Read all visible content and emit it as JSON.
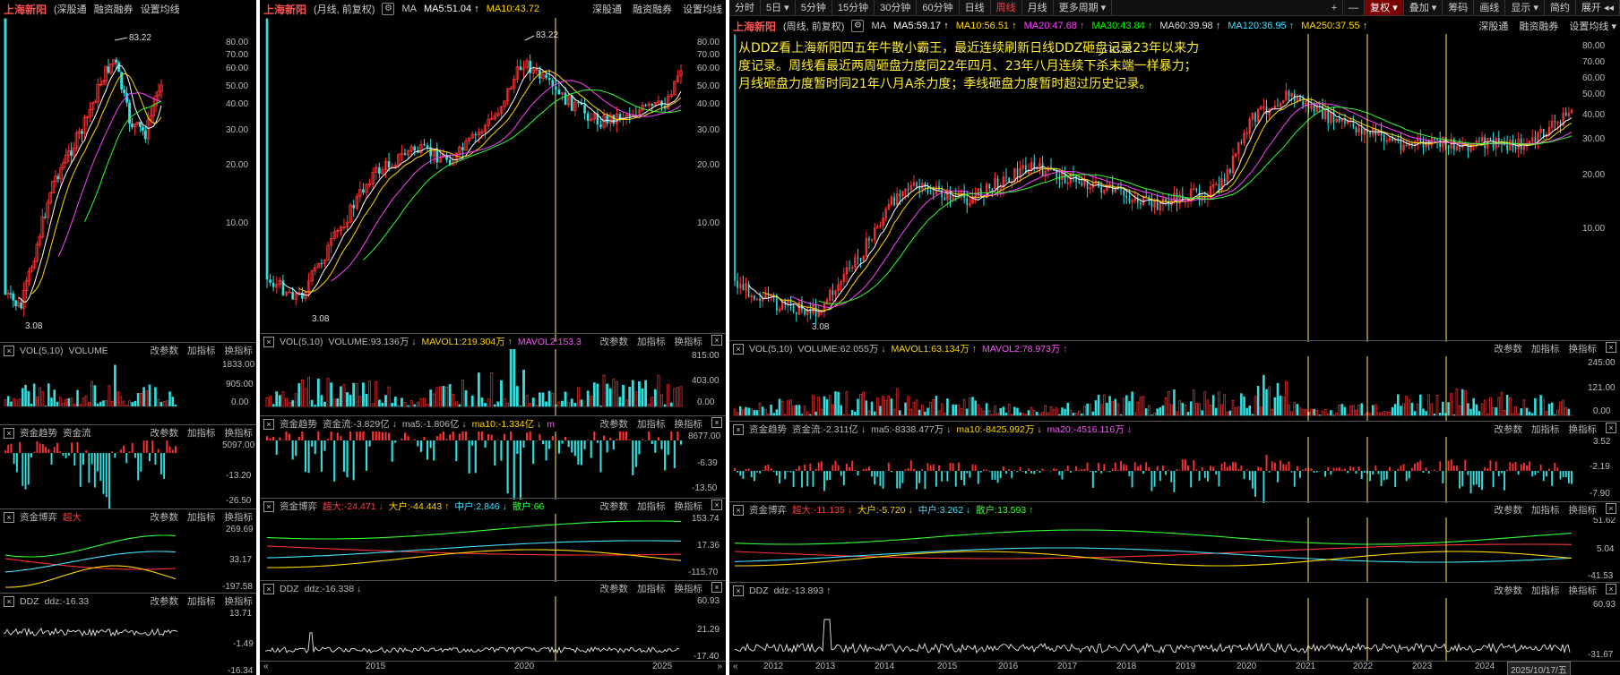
{
  "colors": {
    "up": "#ff3030",
    "down": "#30e0e0",
    "ma_yellow": "#ffd700",
    "ma_magenta": "#ff40ff",
    "ma_green": "#30ff30",
    "annotation": "#ffee33",
    "vline": "#ffee55"
  },
  "panel1": {
    "stock_name": "上海新阳",
    "tag": "(深股通",
    "links": [
      "融资融券",
      "设置均线"
    ],
    "high_label": "83.22",
    "low_label": "3.08",
    "price_ticks": [
      "80.00",
      "70.00",
      "60.00",
      "50.00",
      "40.00",
      "30.00",
      "20.00",
      "10.00"
    ],
    "vol": {
      "label": "VOL(5,10)",
      "extra": "VOLUME",
      "ticks": [
        "1833.00",
        "905.00",
        "0.00"
      ]
    },
    "fund": {
      "label": "资金趋势",
      "extra": "资金流",
      "ticks": [
        "5097.00",
        "-13.20",
        "-26.50"
      ]
    },
    "game": {
      "label": "资金博弈",
      "extra": "超大",
      "ticks": [
        "269.69",
        "33.17",
        "-197.58"
      ]
    },
    "ddz": {
      "label": "DDZ",
      "value": "ddz:-16.33",
      "ticks": [
        "13.71",
        "-1.49",
        "-16.34"
      ]
    },
    "sub_buttons": [
      "改参数",
      "加指标",
      "换指标"
    ]
  },
  "panel2": {
    "stock_name": "上海新阳",
    "mode": "(月线, 前复权)",
    "ma": {
      "label": "MA",
      "ma5": "MA5:51.04 ↑",
      "ma10": "MA10:43.72"
    },
    "links": [
      "深股通",
      "融资融券",
      "设置均线"
    ],
    "high_label": "83.22",
    "low_label": "3.08",
    "price_ticks": [
      "80.00",
      "70.00",
      "60.00",
      "50.00",
      "40.00",
      "30.00",
      "20.00",
      "10.00"
    ],
    "vol": {
      "label": "VOL(5,10)",
      "volume": "VOLUME:93.136万 ↓",
      "mavol1": "MAVOL1:219.304万 ↑",
      "mavol2": "MAVOL2:153.3",
      "ticks": [
        "815.00",
        "403.00",
        "0.00"
      ]
    },
    "fund": {
      "label": "资金趋势",
      "flow": "资金流:-3.829亿 ↓",
      "ma5": "ma5:-1.806亿 ↓",
      "ma10": "ma10:-1.334亿 ↓",
      "ma20": "m",
      "ticks": [
        "8677.00",
        "-6.39",
        "-13.50"
      ]
    },
    "game": {
      "label": "资金博弈",
      "super": "超大:-24.471 ↓",
      "big": "大户:-44.443 ↑",
      "mid": "中户:2.846 ↓",
      "small": "散户:66",
      "ticks": [
        "153.74",
        "17.36",
        "-115.70"
      ]
    },
    "ddz": {
      "label": "DDZ",
      "value": "ddz:-16.338 ↓",
      "ticks": [
        "60.93",
        "21.29",
        "-17.40"
      ]
    },
    "years": [
      "2015",
      "2020",
      "2025"
    ],
    "sub_buttons": [
      "改参数",
      "加指标",
      "换指标"
    ]
  },
  "panel3": {
    "toolbar": [
      "分时",
      "5日 ▾",
      "5分钟",
      "15分钟",
      "30分钟",
      "60分钟",
      "日线",
      "周线",
      "月线",
      "更多周期 ▾"
    ],
    "toolbar_active": "周线",
    "toolbar_right": [
      "+",
      "—",
      "复权 ▾",
      "叠加 ▾",
      "筹码",
      "画线",
      "显示 ▾",
      "简约",
      "展开 ◂◂"
    ],
    "stock_name": "上海新阳",
    "mode": "(周线, 前复权)",
    "ma": {
      "gear": "⚙",
      "label": "MA",
      "ma5": "MA5:59.17 ↑",
      "ma10": "MA10:56.51 ↑",
      "ma20": "MA20:47.68 ↑",
      "ma30": "MA30:43.84 ↑",
      "ma60": "MA60:39.98 ↑",
      "ma120": "MA120:36.95 ↑",
      "ma250": "MA250:37.55 ↑"
    },
    "links": [
      "深股通",
      "融资融券",
      "设置均线 ▾"
    ],
    "annotation": "从DDZ看上海新阳四五年牛散小霸王，最近连续刷新日线DDZ砸盘记录23年以来力度记录。周线看最近两周砸盘力度同22年四月、23年八月连续下杀末端一样暴力；月线砸盘力度暂时同21年八月A杀力度；季线砸盘力度暂时超过历史记录。",
    "high_label": "83.22",
    "low_label": "3.08",
    "price_ticks": [
      "80.00",
      "70.00",
      "60.00",
      "50.00",
      "40.00",
      "30.00",
      "20.00",
      "10.00"
    ],
    "vol": {
      "label": "VOL(5,10)",
      "volume": "VOLUME:62.055万 ↓",
      "mavol1": "MAVOL1:63.134万 ↑",
      "mavol2": "MAVOL2:78.973万 ↑",
      "ticks": [
        "245.00",
        "121.00",
        "0.00"
      ]
    },
    "fund": {
      "label": "资金趋势",
      "flow": "资金流:-2.311亿 ↓",
      "ma5": "ma5:-8338.477万 ↓",
      "ma10": "ma10:-8425.992万 ↓",
      "ma20": "ma20:-4516.116万 ↓",
      "ticks": [
        "3.52",
        "-2.19",
        "-7.90"
      ]
    },
    "game": {
      "label": "资金博弈",
      "super": "超大:-11.135 ↓",
      "big": "大户:-5.720 ↓",
      "mid": "中户:3.262 ↓",
      "small": "散户:13.593 ↑",
      "ticks": [
        "51.62",
        "5.04",
        "-41.53"
      ]
    },
    "ddz": {
      "label": "DDZ",
      "value": "ddz:-13.893 ↑",
      "ticks": [
        "60.93",
        "-31.67"
      ]
    },
    "years": [
      "2012",
      "2013",
      "2014",
      "2015",
      "2016",
      "2017",
      "2018",
      "2019",
      "2020",
      "2021",
      "2022",
      "2023",
      "2024"
    ],
    "date_box": "2025/10/17/五",
    "sub_buttons": [
      "改参数",
      "加指标",
      "换指标"
    ]
  }
}
